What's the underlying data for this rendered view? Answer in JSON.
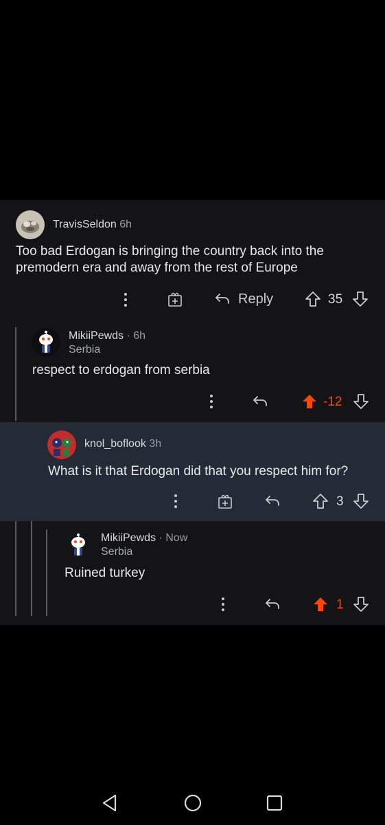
{
  "comments": [
    {
      "username": "TravisSeldon",
      "time": "6h",
      "flair": "",
      "body_line1": "Too bad Erdogan is bringing the country back into the",
      "body_line2": "premodern era and away from the rest of Europe",
      "reply_label": "Reply",
      "score": "35",
      "vote_state": "none"
    },
    {
      "username": "MikiiPewds",
      "separator": "·",
      "time": "6h",
      "flair": "Serbia",
      "body": "respect to erdogan from serbia",
      "score": "-12",
      "vote_state": "upvoted"
    },
    {
      "username": "knol_boflook",
      "time": "3h",
      "flair": "",
      "body": "What is it that Erdogan did that you respect him for?",
      "score": "3",
      "vote_state": "none"
    },
    {
      "username": "MikiiPewds",
      "separator": "·",
      "time": "Now",
      "flair": "Serbia",
      "body": "Ruined turkey",
      "score": "1",
      "vote_state": "upvoted"
    }
  ],
  "colors": {
    "background": "#000000",
    "thread_background": "#141416",
    "highlight_background": "#242a36",
    "upvote_accent": "#ff4500"
  },
  "icons": [
    "more-icon",
    "award-icon",
    "reply-icon",
    "upvote-icon",
    "downvote-icon",
    "nav-back-icon",
    "nav-home-icon",
    "nav-recents-icon"
  ]
}
